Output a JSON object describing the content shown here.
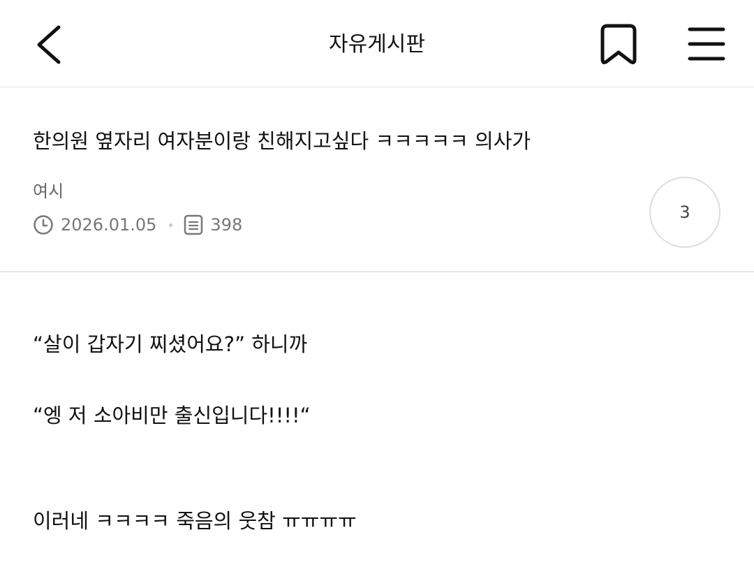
{
  "header": {
    "title": "자유게시판",
    "back_icon": "chevron-left-icon",
    "bookmark_icon": "bookmark-icon",
    "menu_icon": "hamburger-menu-icon"
  },
  "post": {
    "title": "한의원 옆자리 여자분이랑 친해지고싶다 ㅋㅋㅋㅋㅋ 의사가",
    "author": "여시",
    "date": "2026.01.05",
    "views": "398",
    "comment_count": "3"
  },
  "content": {
    "lines": [
      "“살이 갑자기 찌셨어요?” 하니까",
      "“엥 저 소아비만 출신입니다!!!!“",
      "이러네 ㅋㅋㅋㅋ 죽음의 웃참 ㅠㅠㅠㅠ"
    ]
  },
  "colors": {
    "text": "#111111",
    "muted": "#777777",
    "divider": "#e6e6e6"
  }
}
